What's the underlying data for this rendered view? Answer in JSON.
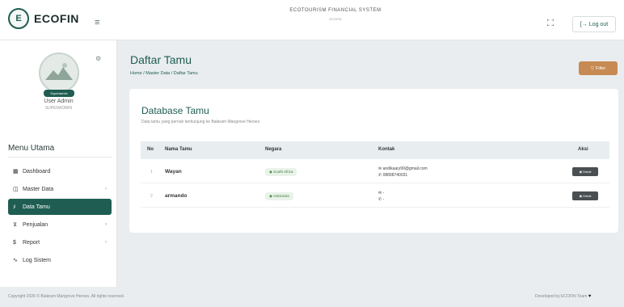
{
  "brand": {
    "name": "ECOFIN",
    "logo_text": "E"
  },
  "header": {
    "system_title": "ECOTOURISM FINANCIAL SYSTEM",
    "system_sub": "ECOFIN",
    "logout_label": "Log out"
  },
  "user": {
    "badge": "Superadmin",
    "name": "User Admin",
    "role": "SUPERADMIN"
  },
  "menu": {
    "title": "Menu Utama",
    "items": [
      {
        "label": "Dashboard",
        "icon": "dashboard-icon",
        "glyph": "▦"
      },
      {
        "label": "Master Data",
        "icon": "database-icon",
        "glyph": "◫"
      },
      {
        "label": "Data Tamu",
        "icon": "users-icon",
        "glyph": "ﾒ"
      },
      {
        "label": "Penjualan",
        "icon": "cart-icon",
        "glyph": "⊻"
      },
      {
        "label": "Report",
        "icon": "dollar-icon",
        "glyph": "$"
      },
      {
        "label": "Log Sistem",
        "icon": "activity-icon",
        "glyph": "∿"
      }
    ]
  },
  "page": {
    "title": "Daftar Tamu",
    "breadcrumb": "Home / Master Data / Daftar Tamu",
    "filter_label": "Filter"
  },
  "card": {
    "title": "Database Tamu",
    "subtitle": "Data tamu yang pernah berkunjung ke Balaram Mangrove Heroes"
  },
  "table": {
    "headers": {
      "no": "No",
      "name": "Nama Tamu",
      "country": "Negara",
      "contact": "Kontak",
      "action": "Aksi"
    },
    "rows": [
      {
        "no": "1",
        "name": "Wayan",
        "country": "South Africa",
        "email": "andikaary99@gmail.com",
        "phone": "08898740031",
        "action": "Detail"
      },
      {
        "no": "2",
        "name": "armando",
        "country": "Indonesia",
        "email": "-",
        "phone": "-",
        "action": "Detail"
      }
    ]
  },
  "footer": {
    "left": "Copyright 2026 © Balaram Mangrove Heroes. All rights reserved.",
    "right": "Developed by ECOFIN Team"
  },
  "colors": {
    "primary": "#1f5d52",
    "filter": "#c78a52",
    "detail": "#4a4f52"
  }
}
